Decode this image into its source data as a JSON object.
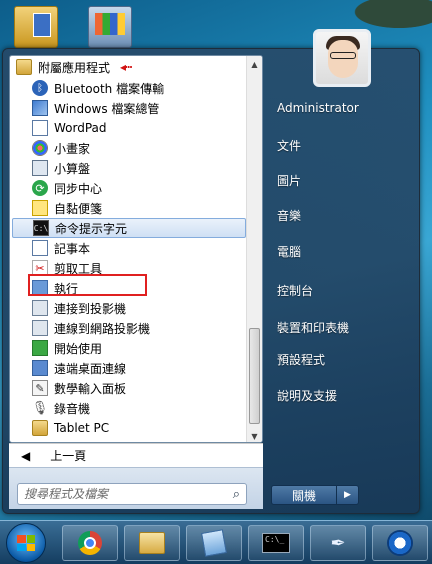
{
  "programs": {
    "root_folder": "附屬應用程式",
    "items": [
      {
        "label": "Bluetooth 檔案傳輸",
        "icon": "bluetooth-icon"
      },
      {
        "label": "Windows 檔案總管",
        "icon": "explorer-icon"
      },
      {
        "label": "WordPad",
        "icon": "wordpad-icon"
      },
      {
        "label": "小畫家",
        "icon": "paint-icon"
      },
      {
        "label": "小算盤",
        "icon": "calculator-icon"
      },
      {
        "label": "同步中心",
        "icon": "sync-center-icon"
      },
      {
        "label": "自黏便箋",
        "icon": "sticky-notes-icon"
      },
      {
        "label": "命令提示字元",
        "icon": "command-prompt-icon"
      },
      {
        "label": "記事本",
        "icon": "notepad-icon"
      },
      {
        "label": "剪取工具",
        "icon": "snipping-tool-icon"
      },
      {
        "label": "執行",
        "icon": "run-icon"
      },
      {
        "label": "連接到投影機",
        "icon": "projector-icon"
      },
      {
        "label": "連線到網路投影機",
        "icon": "network-projector-icon"
      },
      {
        "label": "開始使用",
        "icon": "getting-started-icon"
      },
      {
        "label": "遠端桌面連線",
        "icon": "remote-desktop-icon"
      },
      {
        "label": "數學輸入面板",
        "icon": "math-input-icon"
      },
      {
        "label": "錄音機",
        "icon": "microphone-icon"
      },
      {
        "label": "Tablet PC",
        "icon": "folder-icon"
      }
    ]
  },
  "back_label": "上一頁",
  "search": {
    "placeholder": "搜尋程式及檔案"
  },
  "right_pane": {
    "user": "Administrator",
    "items": [
      "文件",
      "圖片",
      "音樂",
      "電腦",
      "控制台",
      "裝置和印表機",
      "預設程式",
      "說明及支援"
    ]
  },
  "shutdown_label": "關機",
  "taskbar": {
    "apps": [
      "chrome-icon",
      "windows-explorer-icon",
      "notebook-icon",
      "command-prompt-icon",
      "pen-icon",
      "app-swirl-icon"
    ]
  }
}
